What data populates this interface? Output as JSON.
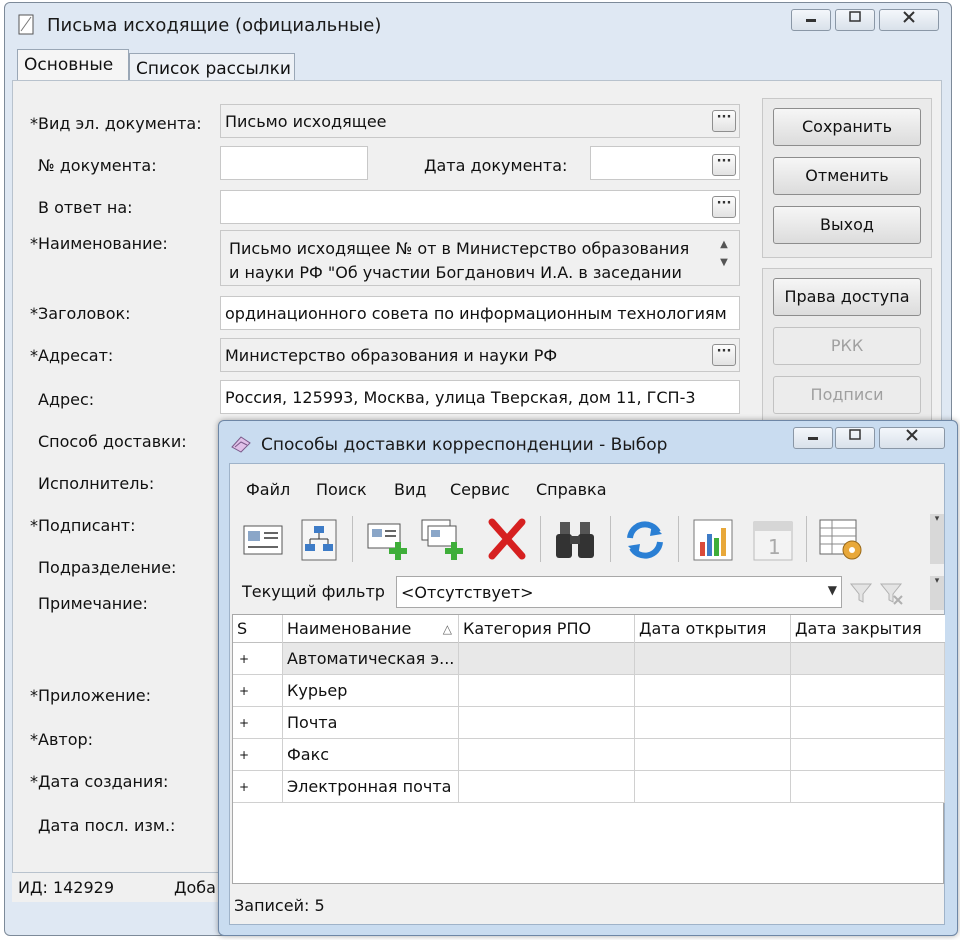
{
  "window": {
    "title": "Письма исходящие (официальные)",
    "min": "▭",
    "max": "◻",
    "close": "✕"
  },
  "tabs": [
    "Основные",
    "Список рассылки"
  ],
  "form": {
    "doc_type_label": "*Вид эл. документа:",
    "doc_type_value": "Письмо исходящее",
    "doc_number_label": "№ документа:",
    "doc_number_value": "",
    "doc_date_label": "Дата документа:",
    "doc_date_value": "",
    "reply_to_label": "В ответ на:",
    "reply_to_value": "",
    "name_label": "*Наименование:",
    "name_line1": "Письмо исходящее № от  в Министерство образования",
    "name_line2": "и науки РФ \"Об участии Богданович И.А. в заседании",
    "heading_label": "*Заголовок:",
    "heading_value": "ординационного совета по информационным технологиям",
    "addressee_label": "*Адресат:",
    "addressee_value": "Министерство образования и науки РФ",
    "address_label": "Адрес:",
    "address_value": "Россия, 125993, Москва, улица Тверская, дом 11, ГСП-3",
    "delivery_label": "Способ доставки:",
    "executor_label": "Исполнитель:",
    "signer_label": "*Подписант:",
    "division_label": "Подразделение:",
    "note_label": "Примечание:",
    "attachment_label": "*Приложение:",
    "author_label": "*Автор:",
    "created_label": "*Дата создания:",
    "modified_label": "Дата посл. изм.:",
    "dots": "···"
  },
  "buttons": {
    "save": "Сохранить",
    "cancel": "Отменить",
    "exit": "Выход",
    "access": "Права доступа",
    "rkk": "РКК",
    "signatures": "Подписи"
  },
  "status": {
    "id": "ИД: 142929",
    "added": "Доба"
  },
  "dialog": {
    "title": "Способы доставки корреспонденции - Выбор",
    "menu": [
      "Файл",
      "Поиск",
      "Вид",
      "Сервис",
      "Справка"
    ],
    "filter_label": "Текущий фильтр",
    "filter_value": "<Отсутствует>",
    "columns": [
      "S",
      "Наименование",
      "Категория РПО",
      "Дата открытия",
      "Дата закрытия"
    ],
    "sort_indicator": "△",
    "rows": [
      {
        "s": "+",
        "name": "Автоматическая э...",
        "category": "",
        "opened": "",
        "closed": ""
      },
      {
        "s": "+",
        "name": "Курьер",
        "category": "",
        "opened": "",
        "closed": ""
      },
      {
        "s": "+",
        "name": "Почта",
        "category": "",
        "opened": "",
        "closed": ""
      },
      {
        "s": "+",
        "name": "Факс",
        "category": "",
        "opened": "",
        "closed": ""
      },
      {
        "s": "+",
        "name": "Электронная почта",
        "category": "",
        "opened": "",
        "closed": ""
      }
    ],
    "records": "Записей: 5",
    "toolbar_icons": [
      "card-icon",
      "hierarchy-icon",
      "add-record-icon",
      "add-copy-icon",
      "delete-icon",
      "binoculars-icon",
      "refresh-icon",
      "chart-icon",
      "calendar-icon",
      "table-settings-icon"
    ]
  },
  "colors": {
    "title_bar": "#dfe8f3",
    "dialog_frame": "#c9dcf0",
    "delete_red": "#d62020",
    "refresh_blue": "#2a7fd4",
    "add_green": "#3fae3a"
  }
}
